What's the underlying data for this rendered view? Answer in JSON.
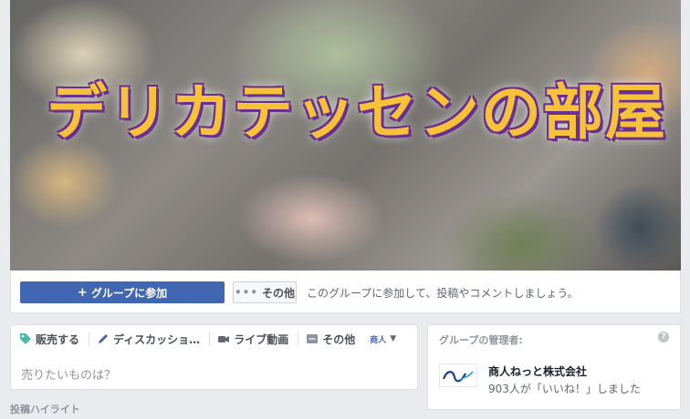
{
  "cover": {
    "title": "デリカテッセンの部屋"
  },
  "actions": {
    "join_label": "グループに参加",
    "more_label": "その他",
    "hint": "このグループに参加して、投稿やコメントしましょう。"
  },
  "composer": {
    "tabs": [
      {
        "label": "販売する",
        "icon": "tag-icon"
      },
      {
        "label": "ディスカッショ…",
        "icon": "pencil-icon"
      },
      {
        "label": "ライブ動画",
        "icon": "video-camera-icon"
      },
      {
        "label": "その他",
        "icon": "more-icon"
      }
    ],
    "audience_label": "商人",
    "placeholder": "売りたいものは？"
  },
  "admins": {
    "heading": "グループの管理者:",
    "name": "商人ねっと株式会社",
    "likes": "903人が「いいね！」しました"
  },
  "highlights": {
    "label": "投稿ハイライト"
  },
  "colors": {
    "primary": "#4267b2",
    "title_fill": "#f5c23a",
    "title_outline": "#6a2f8f"
  }
}
